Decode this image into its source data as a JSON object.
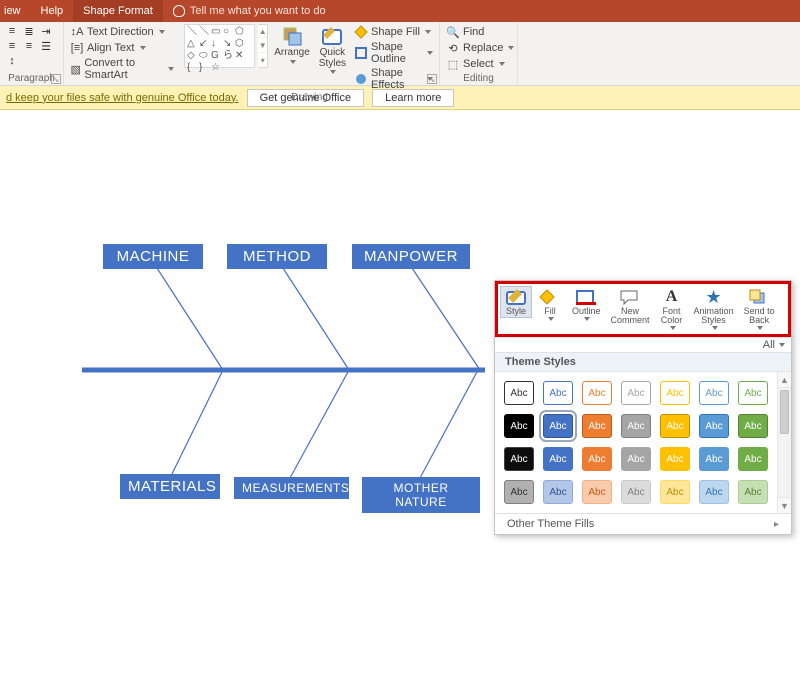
{
  "tabs": {
    "partial": "iew",
    "help": "Help",
    "shape_format": "Shape Format"
  },
  "tellme_placeholder": "Tell me what you want to do",
  "ribbon": {
    "paragraph": {
      "label": "Paragraph",
      "text_direction": "Text Direction",
      "align_text": "Align Text",
      "convert_smartart": "Convert to SmartArt"
    },
    "drawing": {
      "label": "Drawing",
      "arrange": "Arrange",
      "quick_styles": "Quick\nStyles",
      "shape_fill": "Shape Fill",
      "shape_outline": "Shape Outline",
      "shape_effects": "Shape Effects"
    },
    "editing": {
      "label": "Editing",
      "find": "Find",
      "replace": "Replace",
      "select": "Select"
    }
  },
  "yellowbar": {
    "msg": "d keep your files safe with genuine Office today.",
    "get_genuine": "Get genuine Office",
    "learn_more": "Learn more"
  },
  "fishbone": {
    "top": [
      "MACHINE",
      "METHOD",
      "MANPOWER"
    ],
    "bottom": [
      "MATERIALS",
      "MEASUREMENTS",
      "MOTHER NATURE"
    ]
  },
  "popup": {
    "buttons": {
      "style": "Style",
      "fill": "Fill",
      "outline": "Outline",
      "new_comment": "New\nComment",
      "font_color": "Font\nColor",
      "anim_styles": "Animation\nStyles",
      "send_back": "Send to\nBack"
    },
    "all": "All",
    "theme_header": "Theme Styles",
    "swatch_text": "Abc",
    "other": "Other Theme Fills",
    "rows": [
      [
        {
          "bg": "#ffffff",
          "fg": "#333333",
          "border": "#333333"
        },
        {
          "bg": "#ffffff",
          "fg": "#4472c4",
          "border": "#4472c4"
        },
        {
          "bg": "#ffffff",
          "fg": "#ed7d31",
          "border": "#ed7d31"
        },
        {
          "bg": "#ffffff",
          "fg": "#a5a5a5",
          "border": "#a5a5a5"
        },
        {
          "bg": "#ffffff",
          "fg": "#ffc000",
          "border": "#ffc000"
        },
        {
          "bg": "#ffffff",
          "fg": "#5b9bd5",
          "border": "#5b9bd5"
        },
        {
          "bg": "#ffffff",
          "fg": "#70ad47",
          "border": "#70ad47"
        }
      ],
      [
        {
          "bg": "#000000",
          "fg": "#ffffff",
          "border": "#000000"
        },
        {
          "bg": "#4472c4",
          "fg": "#ffffff",
          "border": "#2f5597",
          "sel": true
        },
        {
          "bg": "#ed7d31",
          "fg": "#ffffff",
          "border": "#c55a11"
        },
        {
          "bg": "#a5a5a5",
          "fg": "#ffffff",
          "border": "#7f7f7f"
        },
        {
          "bg": "#ffc000",
          "fg": "#ffffff",
          "border": "#bf9000"
        },
        {
          "bg": "#5b9bd5",
          "fg": "#ffffff",
          "border": "#2e75b6"
        },
        {
          "bg": "#70ad47",
          "fg": "#ffffff",
          "border": "#548235"
        }
      ],
      [
        {
          "bg": "#0d0d0d",
          "fg": "#ffffff",
          "border": "#404040"
        },
        {
          "bg": "#4472c4",
          "fg": "#ffffff",
          "border": "#4472c4"
        },
        {
          "bg": "#ed7d31",
          "fg": "#ffffff",
          "border": "#ed7d31"
        },
        {
          "bg": "#a5a5a5",
          "fg": "#ffffff",
          "border": "#a5a5a5"
        },
        {
          "bg": "#ffc000",
          "fg": "#ffffff",
          "border": "#ffc000"
        },
        {
          "bg": "#5b9bd5",
          "fg": "#ffffff",
          "border": "#5b9bd5"
        },
        {
          "bg": "#70ad47",
          "fg": "#ffffff",
          "border": "#70ad47"
        }
      ],
      [
        {
          "bg": "#b0b0b0",
          "fg": "#333333",
          "border": "#808080"
        },
        {
          "bg": "#b4c7e7",
          "fg": "#2f5597",
          "border": "#8faadc"
        },
        {
          "bg": "#f8cbad",
          "fg": "#c55a11",
          "border": "#f4b183"
        },
        {
          "bg": "#dbdbdb",
          "fg": "#7f7f7f",
          "border": "#c9c9c9"
        },
        {
          "bg": "#ffe699",
          "fg": "#bf9000",
          "border": "#ffd966"
        },
        {
          "bg": "#bdd7ee",
          "fg": "#2e75b6",
          "border": "#9dc3e6"
        },
        {
          "bg": "#c5e0b4",
          "fg": "#548235",
          "border": "#a9d18e"
        }
      ]
    ]
  }
}
